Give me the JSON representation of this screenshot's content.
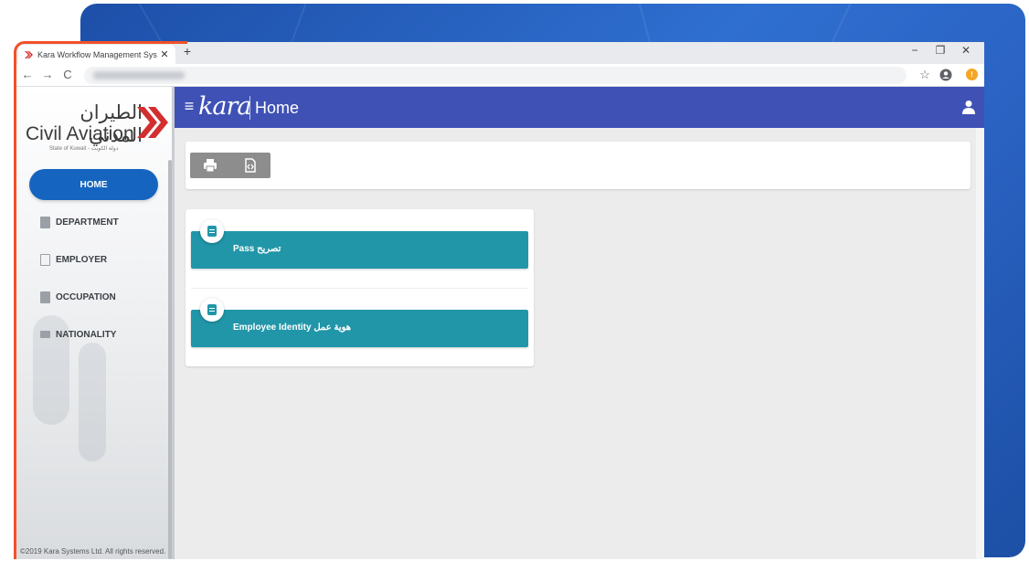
{
  "browser": {
    "tab_title": "Kara Workflow Management Sys",
    "tab_close": "✕",
    "new_tab": "+",
    "minimize": "−",
    "restore": "❐",
    "close": "✕",
    "back": "←",
    "forward": "→",
    "reload": "C",
    "star": "☆",
    "badge": "!"
  },
  "logo": {
    "arabic": "الطيران المدني",
    "english": "Civil Aviation",
    "subtitle": "State of Kuwait - دولة الكويت"
  },
  "sidebar": {
    "items": [
      {
        "label": "HOME",
        "active": true
      },
      {
        "label": "DEPARTMENT",
        "active": false
      },
      {
        "label": "EMPLOYER",
        "active": false
      },
      {
        "label": "OCCUPATION",
        "active": false
      },
      {
        "label": "NATIONALITY",
        "active": false
      }
    ],
    "footer": "©2019 Kara Systems Ltd. All rights reserved."
  },
  "topbar": {
    "menu_glyph": "≡",
    "brand": "kara",
    "title": "Home"
  },
  "toolbar": {
    "print_icon": "printer-icon",
    "export_icon": "code-file-icon"
  },
  "cards": [
    {
      "label": "Pass تصريح"
    },
    {
      "label": "Employee Identity هوية عمل"
    }
  ],
  "colors": {
    "topbar": "#3f51b5",
    "active_nav": "#1565c0",
    "card": "#2196a8",
    "highlight": "#f0512a",
    "backdrop": "#2f6fd0"
  }
}
